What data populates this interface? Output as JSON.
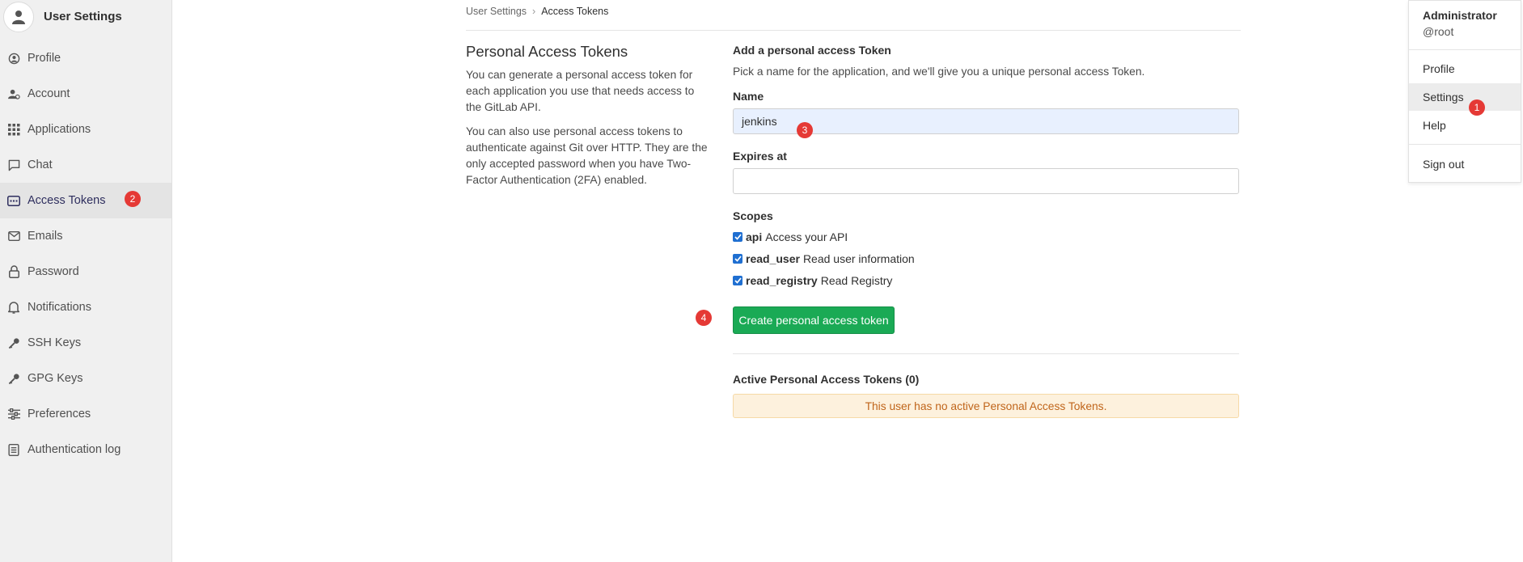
{
  "sidebar": {
    "title": "User Settings",
    "items": [
      {
        "label": "Profile",
        "icon": "profile-icon"
      },
      {
        "label": "Account",
        "icon": "account-icon"
      },
      {
        "label": "Applications",
        "icon": "applications-icon"
      },
      {
        "label": "Chat",
        "icon": "chat-icon"
      },
      {
        "label": "Access Tokens",
        "icon": "token-icon",
        "active": true
      },
      {
        "label": "Emails",
        "icon": "email-icon"
      },
      {
        "label": "Password",
        "icon": "lock-icon"
      },
      {
        "label": "Notifications",
        "icon": "bell-icon"
      },
      {
        "label": "SSH Keys",
        "icon": "key-icon"
      },
      {
        "label": "GPG Keys",
        "icon": "key-icon"
      },
      {
        "label": "Preferences",
        "icon": "sliders-icon"
      },
      {
        "label": "Authentication log",
        "icon": "log-icon"
      }
    ]
  },
  "breadcrumb": {
    "parent": "User Settings",
    "current": "Access Tokens"
  },
  "description": {
    "title": "Personal Access Tokens",
    "p1": "You can generate a personal access token for each application you use that needs access to the GitLab API.",
    "p2": "You can also use personal access tokens to authenticate against Git over HTTP. They are the only accepted password when you have Two-Factor Authentication (2FA) enabled."
  },
  "form": {
    "title": "Add a personal access Token",
    "subtitle": "Pick a name for the application, and we'll give you a unique personal access Token.",
    "name_label": "Name",
    "name_value": "jenkins",
    "expires_label": "Expires at",
    "expires_value": "",
    "scopes_label": "Scopes",
    "scopes": [
      {
        "name": "api",
        "description": "Access your API",
        "checked": true
      },
      {
        "name": "read_user",
        "description": "Read user information",
        "checked": true
      },
      {
        "name": "read_registry",
        "description": "Read Registry",
        "checked": true
      }
    ],
    "submit_label": "Create personal access token"
  },
  "active_tokens": {
    "title": "Active Personal Access Tokens (0)",
    "empty_message": "This user has no active Personal Access Tokens."
  },
  "user_menu": {
    "name": "Administrator",
    "username": "@root",
    "items": [
      "Profile",
      "Settings",
      "Help"
    ],
    "sign_out": "Sign out"
  },
  "markers": [
    "1",
    "2",
    "3",
    "4"
  ],
  "colors": {
    "primary_button": "#1aaa55",
    "marker": "#e53935",
    "warning_bg": "#fdf1dd",
    "warning_text": "#c0651b",
    "checkbox": "#1f6fd1"
  }
}
